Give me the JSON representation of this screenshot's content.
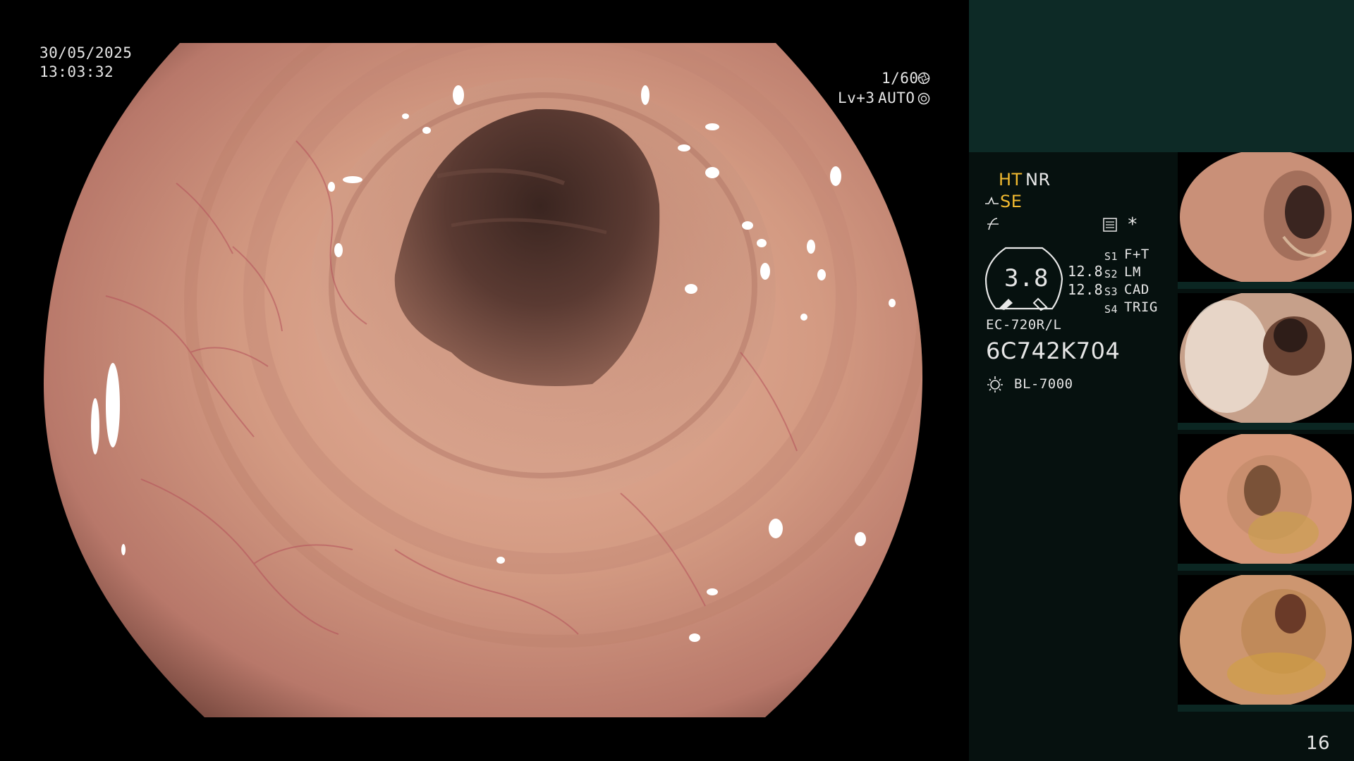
{
  "overlay": {
    "date": "30/05/2025",
    "time": "13:03:32",
    "shutter": "1/60",
    "exposure_level": "Lv+3",
    "exposure_mode": "AUTO"
  },
  "panel": {
    "ht_label": "HT",
    "nr_label": "NR",
    "se_label": "SE",
    "scope_value": "3.8",
    "scope_left": "12.8",
    "scope_right": "12.8",
    "switches": [
      {
        "key": "S1",
        "value": "F+T"
      },
      {
        "key": "S2",
        "value": "LM"
      },
      {
        "key": "S3",
        "value": "CAD"
      },
      {
        "key": "S4",
        "value": "TRIG"
      }
    ],
    "star": "*",
    "model": "EC-720R/L",
    "serial": "6C742K704",
    "light_source": "BL-7000",
    "page_number": "16"
  },
  "colors": {
    "accent_yellow": "#f0b930",
    "panel_bg": "#06110f",
    "panel_header": "#0d2a26",
    "mucosa": "#d49a82"
  },
  "icons": {
    "shutter": "aperture-icon",
    "exposure": "iris-icon",
    "se": "structure-enhance-icon",
    "curve": "gamma-curve-icon",
    "memory": "memory-icon",
    "light": "light-source-icon"
  }
}
